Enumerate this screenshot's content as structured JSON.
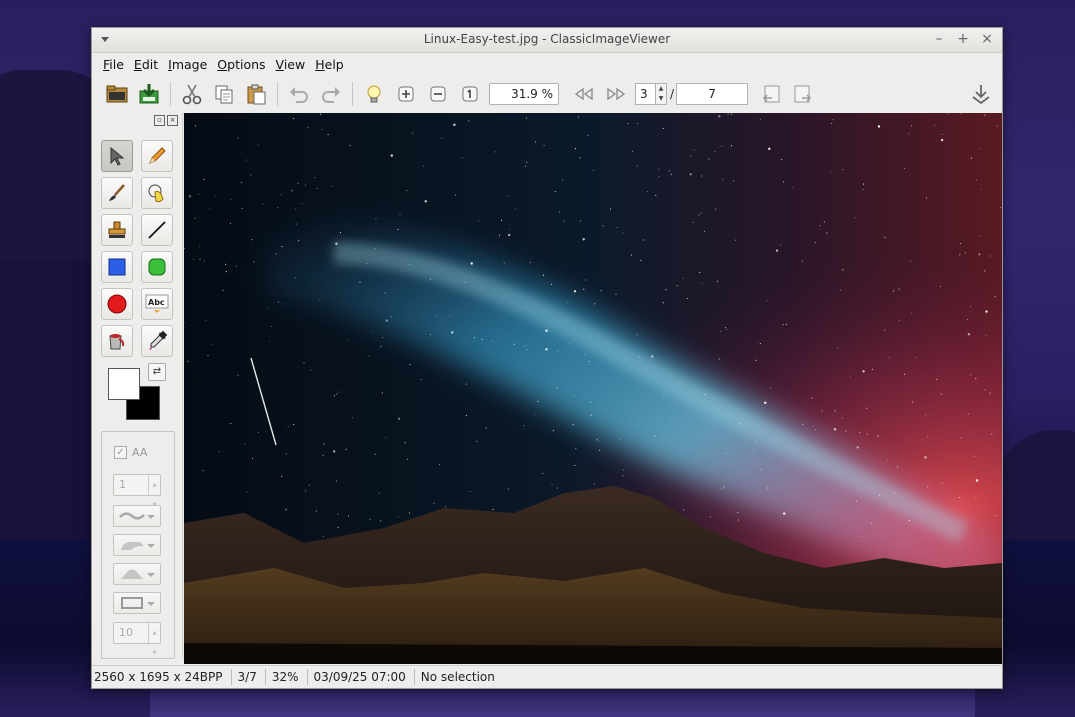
{
  "window": {
    "title": "Linux-Easy-test.jpg - ClassicImageViewer",
    "controls": {
      "minimize": "–",
      "maximize": "+",
      "close": "×"
    }
  },
  "menu": [
    {
      "label": "File",
      "accel": "F",
      "rest": "ile"
    },
    {
      "label": "Edit",
      "accel": "E",
      "rest": "dit"
    },
    {
      "label": "Image",
      "accel": "I",
      "rest": "mage"
    },
    {
      "label": "Options",
      "accel": "O",
      "rest": "ptions"
    },
    {
      "label": "View",
      "accel": "V",
      "rest": "iew"
    },
    {
      "label": "Help",
      "accel": "H",
      "rest": "elp"
    }
  ],
  "toolbar": {
    "zoom_value": "31.9 %",
    "page_current": "3",
    "page_separator": "/",
    "page_total": "7",
    "icons": [
      "open-folder-icon",
      "save-icon",
      "cut-icon",
      "copy-icon",
      "paste-icon",
      "undo-icon",
      "redo-icon",
      "bulb-icon",
      "zoom-in-icon",
      "zoom-out-icon",
      "actual-size-icon",
      "first-page-icon",
      "last-page-icon",
      "rotate-left-icon",
      "rotate-right-icon",
      "download-icon"
    ]
  },
  "tools": {
    "panel_buttons": {
      "float": "▫",
      "close": "×"
    },
    "items": [
      "select",
      "pencil",
      "brush",
      "hand",
      "stamp",
      "line",
      "rectangle",
      "rounded-rectangle",
      "ellipse",
      "text",
      "fill",
      "color-picker"
    ],
    "active": "select",
    "foreground_color": "#ffffff",
    "background_color": "#000000",
    "swap_label": "⇄"
  },
  "options": {
    "aa_label": "AA",
    "aa_check": "✓",
    "width_value": "1",
    "size_value": "10"
  },
  "status": {
    "dimensions": "2560 x 1695 x 24BPP",
    "index": "3/7",
    "zoom": "32%",
    "datetime": "03/09/25 07:00",
    "selection": "No selection"
  },
  "colors": {
    "window_bg": "#eeedeb",
    "wallpaper_top": "#2a1f5e",
    "sky_cyan": "#4fb3d8",
    "sky_red": "#d9405a"
  }
}
